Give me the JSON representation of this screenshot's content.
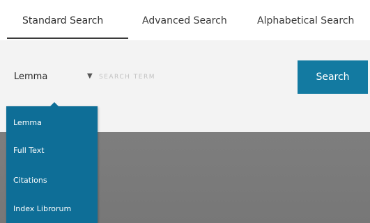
{
  "tabs": {
    "standard": "Standard Search",
    "advanced": "Advanced Search",
    "alphabetical": "Alphabetical Search"
  },
  "search": {
    "type_selected": "Lemma",
    "placeholder": "SEARCH TERM",
    "button_label": "Search"
  },
  "dropdown": {
    "items": [
      "Lemma",
      "Full Text",
      "Citations",
      "Index Librorum"
    ]
  },
  "colors": {
    "accent": "#137aa1",
    "dropdown_bg": "#0e6e97",
    "overlay": "#7b7b7b"
  }
}
